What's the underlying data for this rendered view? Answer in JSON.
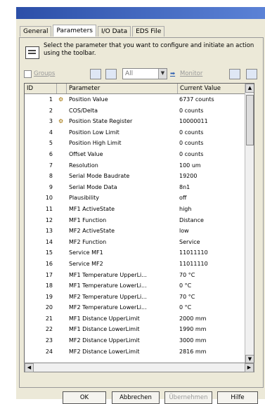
{
  "tabs": [
    {
      "label": "General"
    },
    {
      "label": "Parameters"
    },
    {
      "label": "I/O Data"
    },
    {
      "label": "EDS File"
    }
  ],
  "instruction": "Select the parameter that you want to configure and initiate an action using the toolbar.",
  "toolbar": {
    "groups_label": "Groups",
    "filter_value": "All",
    "monitor_label": "Monitor"
  },
  "table": {
    "headers": {
      "id": "ID",
      "parameter": "Parameter",
      "value": "Current Value"
    },
    "rows": [
      {
        "id": "1",
        "name": "Position Value",
        "value": "6737 counts",
        "locked": true
      },
      {
        "id": "2",
        "name": "COS/Delta",
        "value": "0 counts",
        "locked": false
      },
      {
        "id": "3",
        "name": "Position State Register",
        "value": "10000011",
        "locked": true
      },
      {
        "id": "4",
        "name": "Position Low Limit",
        "value": "0 counts",
        "locked": false
      },
      {
        "id": "5",
        "name": "Position High Limit",
        "value": "0 counts",
        "locked": false
      },
      {
        "id": "6",
        "name": "Offset Value",
        "value": "0 counts",
        "locked": false
      },
      {
        "id": "7",
        "name": "Resolution",
        "value": "100 um",
        "locked": false
      },
      {
        "id": "8",
        "name": "Serial Mode Baudrate",
        "value": "19200",
        "locked": false
      },
      {
        "id": "9",
        "name": "Serial Mode Data",
        "value": "8n1",
        "locked": false
      },
      {
        "id": "10",
        "name": "Plausibility",
        "value": "off",
        "locked": false
      },
      {
        "id": "11",
        "name": "MF1 ActiveState",
        "value": "high",
        "locked": false
      },
      {
        "id": "12",
        "name": "MF1 Function",
        "value": "Distance",
        "locked": false
      },
      {
        "id": "13",
        "name": "MF2 ActiveState",
        "value": "low",
        "locked": false
      },
      {
        "id": "14",
        "name": "MF2 Function",
        "value": "Service",
        "locked": false
      },
      {
        "id": "15",
        "name": "Service MF1",
        "value": "11011110",
        "locked": false
      },
      {
        "id": "16",
        "name": "Service MF2",
        "value": "11011110",
        "locked": false
      },
      {
        "id": "17",
        "name": "MF1 Temperature UpperLi...",
        "value": "70 °C",
        "locked": false
      },
      {
        "id": "18",
        "name": "MF1 Temperature LowerLi...",
        "value": "0 °C",
        "locked": false
      },
      {
        "id": "19",
        "name": "MF2 Temperature UpperLi...",
        "value": "70 °C",
        "locked": false
      },
      {
        "id": "20",
        "name": "MF2 Temperature LowerLi...",
        "value": "0 °C",
        "locked": false
      },
      {
        "id": "21",
        "name": "MF1 Distance UpperLimit",
        "value": "2000 mm",
        "locked": false
      },
      {
        "id": "22",
        "name": "MF1 Distance LowerLimit",
        "value": "1990 mm",
        "locked": false
      },
      {
        "id": "23",
        "name": "MF2 Distance UpperLimit",
        "value": "3000 mm",
        "locked": false
      },
      {
        "id": "24",
        "name": "MF2 Distance LowerLimit",
        "value": "2816 mm",
        "locked": false
      }
    ]
  },
  "buttons": {
    "ok": "OK",
    "cancel": "Abbrechen",
    "apply": "Übernehmen",
    "help": "Hilfe"
  }
}
